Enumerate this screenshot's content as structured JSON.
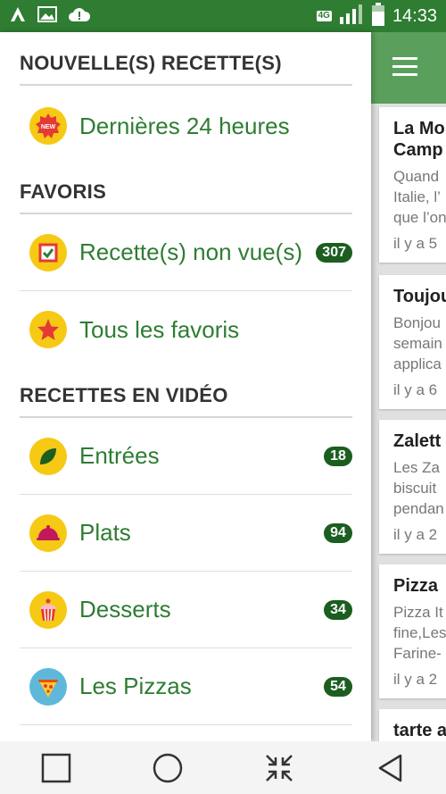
{
  "status_bar": {
    "network": "4G",
    "time": "14:33",
    "icons": [
      "app-a-icon",
      "image-icon",
      "cloud-alert-icon",
      "signal-icon",
      "battery-icon"
    ]
  },
  "drawer": {
    "sections": [
      {
        "title": "NOUVELLE(S) RECETTE(S)",
        "items": [
          {
            "label": "Dernières 24 heures",
            "icon": "new-badge-icon"
          }
        ]
      },
      {
        "title": "FAVORIS",
        "items": [
          {
            "label": "Recette(s) non vue(s)",
            "icon": "checkbox-icon",
            "count": "307"
          },
          {
            "label": "Tous les favoris",
            "icon": "star-icon"
          }
        ]
      },
      {
        "title": "RECETTES EN VIDÉO",
        "items": [
          {
            "label": "Entrées",
            "icon": "leaf-icon",
            "count": "18"
          },
          {
            "label": "Plats",
            "icon": "cloche-icon",
            "count": "94"
          },
          {
            "label": "Desserts",
            "icon": "cupcake-icon",
            "count": "34"
          },
          {
            "label": "Les Pizzas",
            "icon": "pizza-icon",
            "count": "54"
          }
        ]
      }
    ]
  },
  "feed": {
    "cards": [
      {
        "title": "La Mo",
        "title2": "Camp",
        "body": [
          "Quand",
          "Italie, l’",
          "que l’on"
        ],
        "meta": "il y a 5"
      },
      {
        "title": "Toujou",
        "body": [
          "Bonjou",
          "semain",
          "applica"
        ],
        "meta": "il y a 6"
      },
      {
        "title": "Zalett",
        "body": [
          "Les Za",
          "biscuit",
          "pendan"
        ],
        "meta": "il y a 2"
      },
      {
        "title": "Pizza",
        "body": [
          "Pizza It",
          "fine,Les",
          "Farine-"
        ],
        "meta": "il y a 2"
      },
      {
        "title": "tarte a"
      }
    ]
  },
  "colors": {
    "status_bar": "#2e7d32",
    "toolbar": "#5aa05c",
    "accent_text": "#2e7d32",
    "badge": "#1b5e20"
  },
  "navbar": {
    "buttons": [
      "recent-apps-icon",
      "home-icon",
      "collapse-icon",
      "back-icon"
    ]
  }
}
